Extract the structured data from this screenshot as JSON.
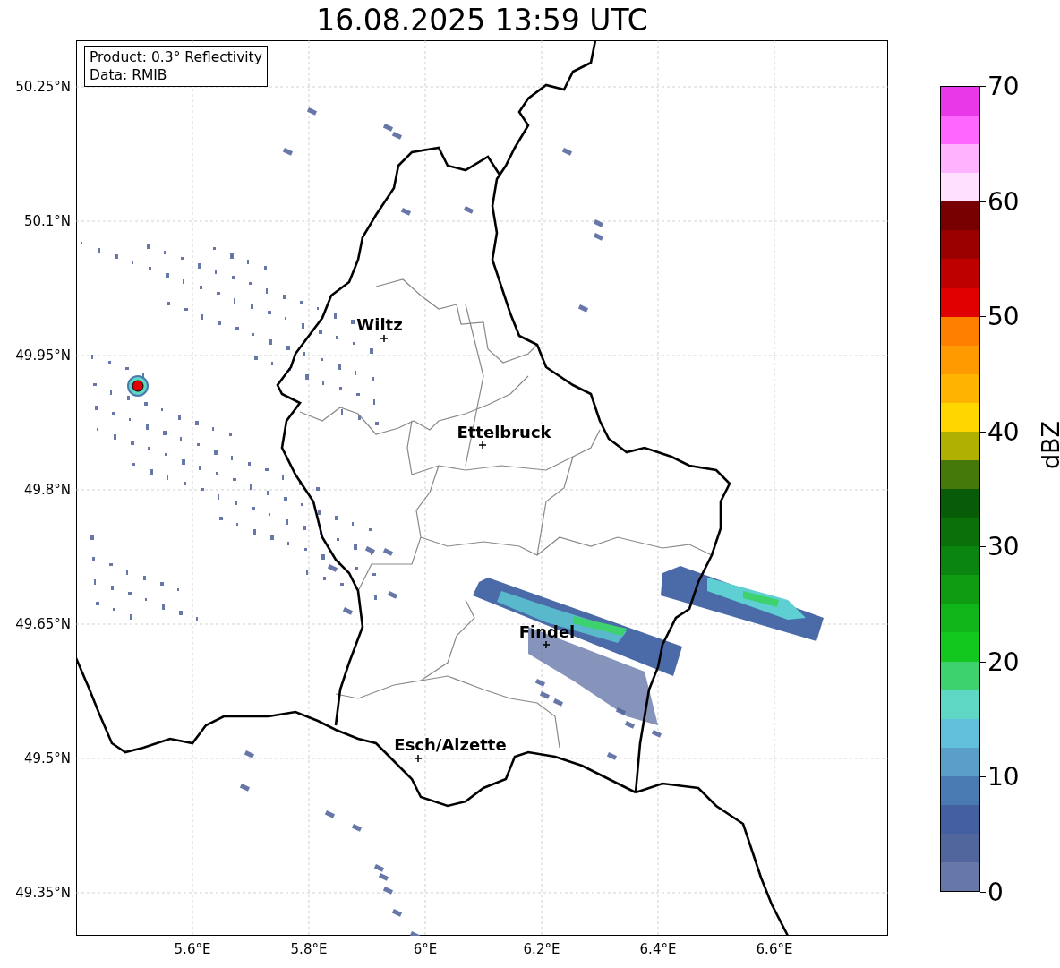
{
  "title": "16.08.2025 13:59 UTC",
  "info_box": [
    "Product: 0.3° Reflectivity",
    "Data: RMIB"
  ],
  "lat_ticks": [
    "50.25°N",
    "50.1°N",
    "49.95°N",
    "49.8°N",
    "49.65°N",
    "49.5°N",
    "49.35°N"
  ],
  "lon_ticks": [
    "5.6°E",
    "5.8°E",
    "6°E",
    "6.2°E",
    "6.4°E",
    "6.6°E"
  ],
  "cities": [
    {
      "name": "Wiltz"
    },
    {
      "name": "Ettelbruck"
    },
    {
      "name": "Findel"
    },
    {
      "name": "Esch/Alzette"
    }
  ],
  "colorbar": {
    "label": "dBZ",
    "ticks": [
      "70",
      "60",
      "50",
      "40",
      "30",
      "20",
      "10",
      "0"
    ],
    "bands": [
      {
        "color": "#e838e8"
      },
      {
        "color": "#ff66ff"
      },
      {
        "color": "#ffb3ff"
      },
      {
        "color": "#ffe0ff"
      },
      {
        "color": "#780000"
      },
      {
        "color": "#9a0000"
      },
      {
        "color": "#bf0000"
      },
      {
        "color": "#e00000"
      },
      {
        "color": "#ff7f00"
      },
      {
        "color": "#ff9a00"
      },
      {
        "color": "#ffb400"
      },
      {
        "color": "#ffd700"
      },
      {
        "color": "#b0b000"
      },
      {
        "color": "#457a0a"
      },
      {
        "color": "#085c08"
      },
      {
        "color": "#0a700a"
      },
      {
        "color": "#0a850f"
      },
      {
        "color": "#0f9b12"
      },
      {
        "color": "#10b51a"
      },
      {
        "color": "#12c81f"
      },
      {
        "color": "#3ed26e"
      },
      {
        "color": "#5ed8c4"
      },
      {
        "color": "#62c0dc"
      },
      {
        "color": "#5a9fc8"
      },
      {
        "color": "#4a7ab2"
      },
      {
        "color": "#4460a0"
      },
      {
        "color": "#52669e"
      },
      {
        "color": "#6677a8"
      }
    ]
  }
}
